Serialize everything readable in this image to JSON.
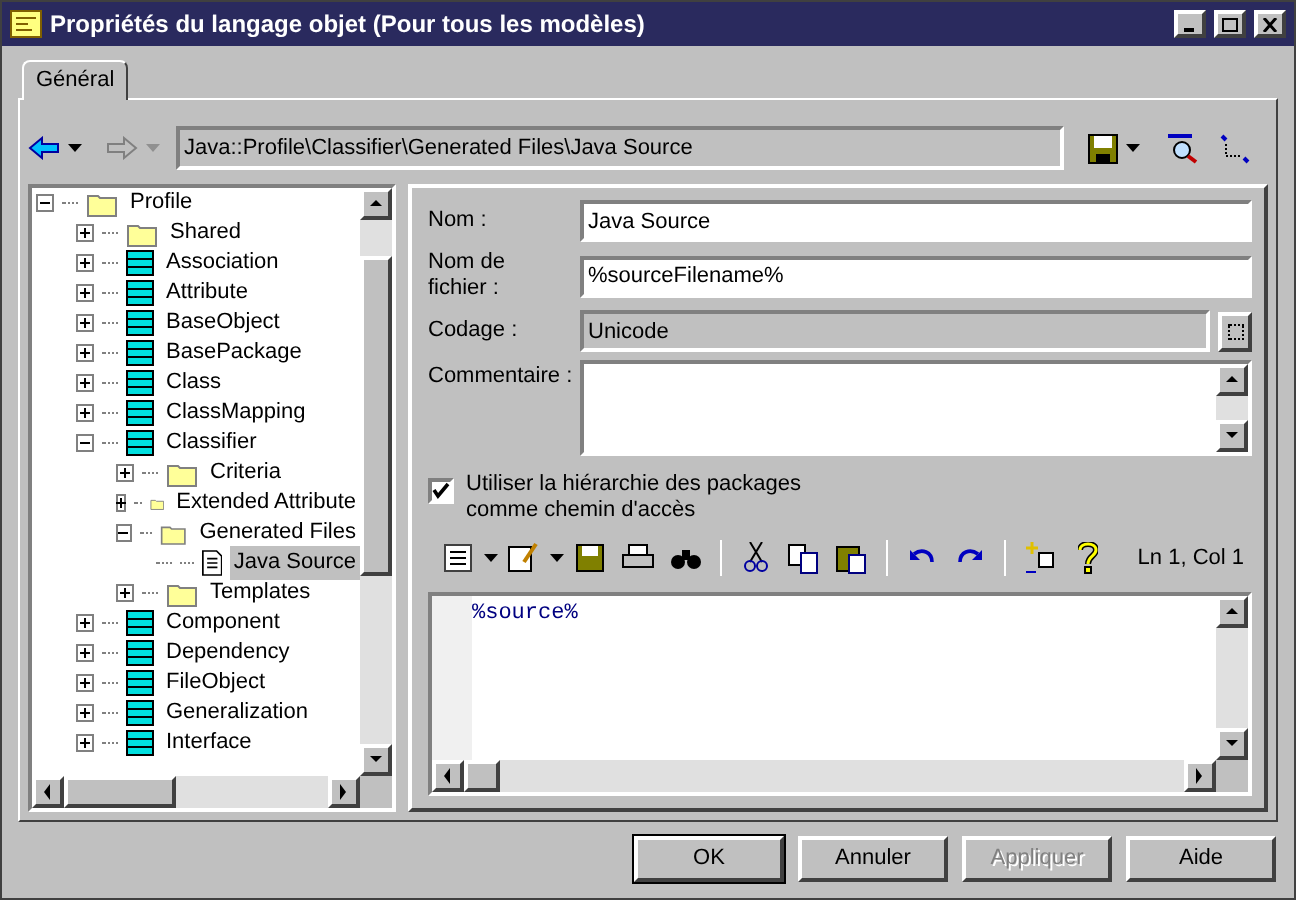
{
  "window": {
    "title": "Propriétés du langage objet (Pour tous les modèles)"
  },
  "tabs": [
    {
      "label": "Général",
      "selected": true
    }
  ],
  "path": "Java::Profile\\Classifier\\Generated Files\\Java Source",
  "tree": [
    {
      "label": "Profile",
      "kind": "folder",
      "expanded": true,
      "selected": false,
      "children": [
        {
          "label": "Shared",
          "kind": "folder",
          "expanded": false,
          "selected": false
        },
        {
          "label": "Association",
          "kind": "class",
          "expanded": false,
          "selected": false
        },
        {
          "label": "Attribute",
          "kind": "class",
          "expanded": false,
          "selected": false
        },
        {
          "label": "BaseObject",
          "kind": "class",
          "expanded": false,
          "selected": false
        },
        {
          "label": "BasePackage",
          "kind": "class",
          "expanded": false,
          "selected": false
        },
        {
          "label": "Class",
          "kind": "class",
          "expanded": false,
          "selected": false
        },
        {
          "label": "ClassMapping",
          "kind": "class",
          "expanded": false,
          "selected": false
        },
        {
          "label": "Classifier",
          "kind": "class",
          "expanded": true,
          "selected": false,
          "children": [
            {
              "label": "Criteria",
              "kind": "folder",
              "expanded": false,
              "selected": false
            },
            {
              "label": "Extended Attribute",
              "kind": "folder",
              "expanded": false,
              "selected": false
            },
            {
              "label": "Generated Files",
              "kind": "folder",
              "expanded": true,
              "selected": false,
              "children": [
                {
                  "label": "Java Source",
                  "kind": "file",
                  "selected": true
                }
              ]
            },
            {
              "label": "Templates",
              "kind": "folder",
              "expanded": false,
              "selected": false
            }
          ]
        },
        {
          "label": "Component",
          "kind": "class",
          "expanded": false,
          "selected": false
        },
        {
          "label": "Dependency",
          "kind": "class",
          "expanded": false,
          "selected": false
        },
        {
          "label": "FileObject",
          "kind": "class",
          "expanded": false,
          "selected": false
        },
        {
          "label": "Generalization",
          "kind": "class",
          "expanded": false,
          "selected": false
        },
        {
          "label": "Interface",
          "kind": "class",
          "expanded": false,
          "selected": false
        }
      ]
    }
  ],
  "form": {
    "name_label": "Nom :",
    "name_value": "Java Source",
    "filename_label": "Nom de fichier :",
    "filename_value": "%sourceFilename%",
    "encoding_label": "Codage :",
    "encoding_value": "Unicode",
    "comment_label": "Commentaire :"
  },
  "checkbox": {
    "label": "Utiliser la hiérarchie des packages comme chemin d'accès",
    "checked": true
  },
  "cursor_position": "Ln 1, Col 1",
  "code": "%source%",
  "buttons": [
    {
      "label": "OK",
      "disabled": false
    },
    {
      "label": "Annuler",
      "disabled": false
    },
    {
      "label": "Appliquer",
      "disabled": true
    },
    {
      "label": "Aide",
      "disabled": false
    }
  ]
}
